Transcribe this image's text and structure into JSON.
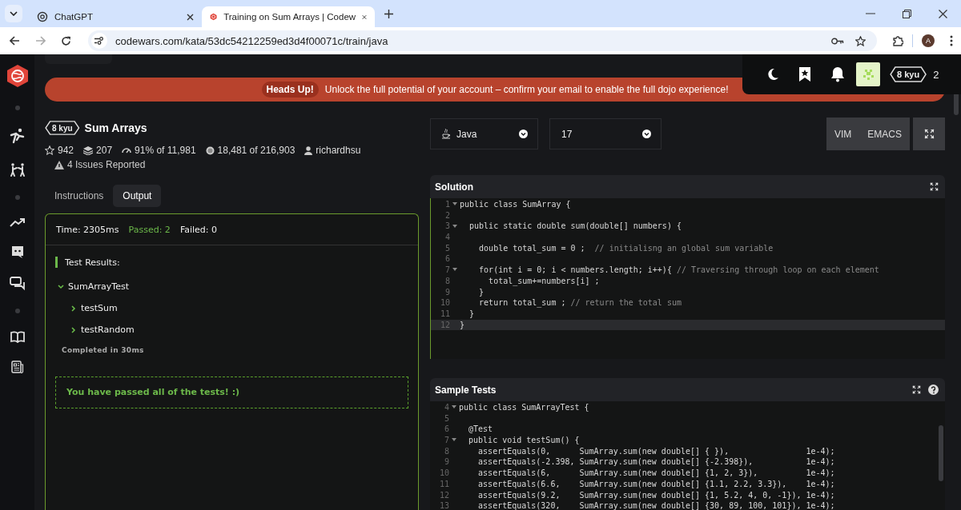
{
  "browser": {
    "tabs": [
      {
        "title": "ChatGPT",
        "selected": false
      },
      {
        "title": "Training on Sum Arrays | Codew",
        "selected": true
      }
    ],
    "url": "codewars.com/kata/53dc54212259ed3d4f00071c/train/java",
    "profile_initial": "A"
  },
  "banner": {
    "badge": "Heads Up!",
    "message": "Unlock the full potential of your account – confirm your email to enable the full dojo experience!"
  },
  "user_menu": {
    "rank": "8 kyu",
    "honor": "2"
  },
  "kata": {
    "rank": "8 kyu",
    "title": "Sum Arrays",
    "stats": [
      {
        "kind": "stars",
        "text": "942"
      },
      {
        "kind": "collections",
        "text": "207"
      },
      {
        "kind": "satisfaction",
        "text": "91% of 11,981"
      },
      {
        "kind": "completions",
        "text": "18,481 of 216,903"
      },
      {
        "kind": "author",
        "text": "richardhsu"
      }
    ],
    "issues": "4 Issues Reported"
  },
  "tabs": [
    {
      "label": "Instructions",
      "selected": false
    },
    {
      "label": "Output",
      "selected": true
    }
  ],
  "output": {
    "time": "Time: 2305ms",
    "passed": "Passed: 2",
    "failed": "Failed: 0",
    "results_title": "Test Results:",
    "tree": [
      {
        "label": "SumArrayTest",
        "expanded": true,
        "children": [
          {
            "label": "testSum",
            "expanded": false
          },
          {
            "label": "testRandom",
            "expanded": false
          }
        ]
      }
    ],
    "completed": "Completed in 30ms",
    "success": "You have passed all of the tests! :)"
  },
  "editor": {
    "language": "Java",
    "version": "17",
    "modes": [
      {
        "label": "VIM",
        "selected": false
      },
      {
        "label": "EMACS",
        "selected": false
      }
    ]
  },
  "solution": {
    "title": "Solution",
    "lines": [
      {
        "number": "1",
        "foldable": true,
        "active": false,
        "code": "public class SumArray {"
      },
      {
        "number": "2",
        "foldable": false,
        "active": false
      },
      {
        "number": "3",
        "foldable": true,
        "active": false,
        "code": "  public static double sum(double[] numbers) {"
      },
      {
        "number": "4",
        "foldable": false,
        "active": false
      },
      {
        "number": "5",
        "foldable": false,
        "active": false,
        "code": "    double total_sum = 0 ;  ",
        "comment": "// initialisng an global sum variable"
      },
      {
        "number": "6",
        "foldable": false,
        "active": false
      },
      {
        "number": "7",
        "foldable": true,
        "active": false,
        "code": "    for(int i = 0; i < numbers.length; i++){ ",
        "comment": "// Traversing through loop on each element"
      },
      {
        "number": "8",
        "foldable": false,
        "active": false,
        "code": "      total_sum+=numbers[i] ;"
      },
      {
        "number": "9",
        "foldable": false,
        "active": false,
        "code": "    }"
      },
      {
        "number": "10",
        "foldable": false,
        "active": false,
        "code": "    return total_sum ; ",
        "comment": "// return the total sum"
      },
      {
        "number": "11",
        "foldable": false,
        "active": false,
        "code": "  }"
      },
      {
        "number": "12",
        "foldable": false,
        "active": true,
        "code": "}"
      }
    ]
  },
  "sample_tests": {
    "title": "Sample Tests",
    "lines": [
      {
        "number": "4",
        "foldable": true,
        "active": false,
        "code": "public class SumArrayTest {"
      },
      {
        "number": "5",
        "foldable": false,
        "active": false
      },
      {
        "number": "6",
        "foldable": false,
        "active": false,
        "code": "  @Test"
      },
      {
        "number": "7",
        "foldable": true,
        "active": false,
        "code": "  public void testSum() {"
      },
      {
        "number": "8",
        "foldable": false,
        "active": false,
        "code": "    assertEquals(0,      SumArray.sum(new double[] { }),                1e-4);"
      },
      {
        "number": "9",
        "foldable": false,
        "active": false,
        "code": "    assertEquals(-2.398, SumArray.sum(new double[] {-2.398}),           1e-4);"
      },
      {
        "number": "10",
        "foldable": false,
        "active": false,
        "code": "    assertEquals(6,      SumArray.sum(new double[] {1, 2, 3}),          1e-4);"
      },
      {
        "number": "11",
        "foldable": false,
        "active": false,
        "code": "    assertEquals(6.6,    SumArray.sum(new double[] {1.1, 2.2, 3.3}),    1e-4);"
      },
      {
        "number": "12",
        "foldable": false,
        "active": false,
        "code": "    assertEquals(9.2,    SumArray.sum(new double[] {1, 5.2, 4, 0, -1}), 1e-4);"
      },
      {
        "number": "13",
        "foldable": false,
        "active": false,
        "code": "    assertEquals(320,    SumArray.sum(new double[] {30, 89, 100, 101}), 1e-4);"
      }
    ]
  }
}
